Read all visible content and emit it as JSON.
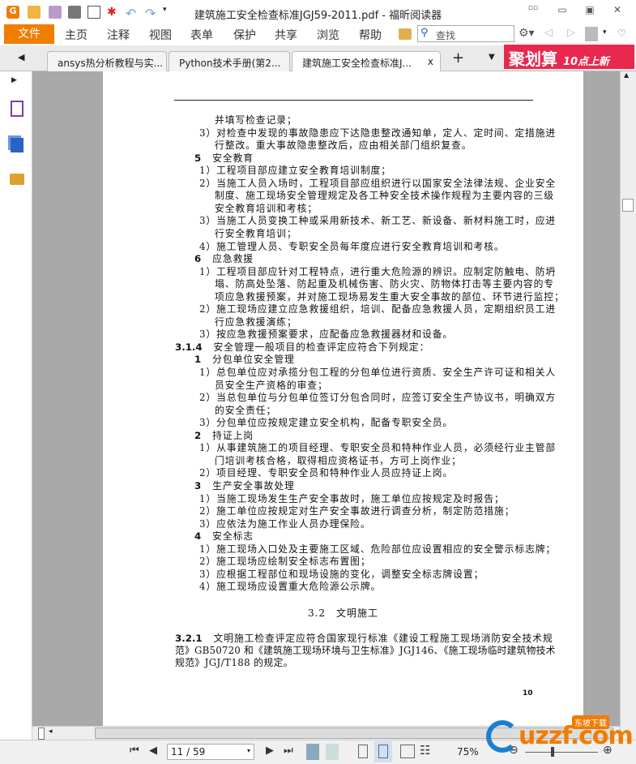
{
  "window": {
    "title": "建筑施工安全检查标准JGJ59-2011.pdf - 福昕阅读器"
  },
  "menu": {
    "file": "文件",
    "items": [
      "主页",
      "注释",
      "视图",
      "表单",
      "保护",
      "共享",
      "浏览",
      "帮助"
    ],
    "search_placeholder": "查找"
  },
  "tabs": [
    {
      "label": "ansys热分析教程与实..."
    },
    {
      "label": "Python技术手册(第2..."
    },
    {
      "label": "建筑施工安全检查标准J...",
      "close": "x"
    }
  ],
  "tab_add": "+",
  "ad": {
    "main": "聚划算",
    "sub": "10点上新"
  },
  "doc": {
    "lines": [
      {
        "t": "并填写检查记录；",
        "k": "c"
      },
      {
        "t": "3）对检查中发现的事故隐患应下达隐患整改通知单，定人、定时间、定措施进",
        "k": "i"
      },
      {
        "t": "行整改。重大事故隐患整改后，应由相关部门组织复查。",
        "k": "c"
      },
      {
        "n": "5",
        "t": "安全教育",
        "k": "h"
      },
      {
        "t": "1）工程项目部应建立安全教育培训制度；",
        "k": "i"
      },
      {
        "t": "2）当施工人员入场时，工程项目部应组织进行以国家安全法律法规、企业安全",
        "k": "i"
      },
      {
        "t": "制度、施工现场安全管理规定及各工种安全技术操作规程为主要内容的三级",
        "k": "c"
      },
      {
        "t": "安全教育培训和考核；",
        "k": "c"
      },
      {
        "t": "3）当施工人员变换工种或采用新技术、新工艺、新设备、新材料施工时，应进",
        "k": "i"
      },
      {
        "t": "行安全教育培训；",
        "k": "c"
      },
      {
        "t": "4）施工管理人员、专职安全员每年度应进行安全教育培训和考核。",
        "k": "i"
      },
      {
        "n": "6",
        "t": "应急救援",
        "k": "h"
      },
      {
        "t": "1）工程项目部应针对工程特点，进行重大危险源的辨识。应制定防触电、防坍",
        "k": "i"
      },
      {
        "t": "塌、防高处坠落、防起重及机械伤害、防火灾、防物体打击等主要内容的专",
        "k": "c"
      },
      {
        "t": "项应急救援预案，并对施工现场易发生重大安全事故的部位、环节进行监控；",
        "k": "c"
      },
      {
        "t": "2）施工现场应建立应急救援组织，培训、配备应急救援人员，定期组织员工进",
        "k": "i"
      },
      {
        "t": "行应急救援演练；",
        "k": "c"
      },
      {
        "t": "3）按应急救援预案要求，应配备应急救援器材和设备。",
        "k": "i"
      },
      {
        "n": "3.1.4",
        "t": "安全管理一般项目的检查评定应符合下列规定：",
        "k": "s"
      },
      {
        "n": "1",
        "t": "分包单位安全管理",
        "k": "h"
      },
      {
        "t": "1）总包单位应对承揽分包工程的分包单位进行资质、安全生产许可证和相关人",
        "k": "i"
      },
      {
        "t": "员安全生产资格的审查；",
        "k": "c"
      },
      {
        "t": "2）当总包单位与分包单位签订分包合同时，应签订安全生产协议书，明确双方",
        "k": "i"
      },
      {
        "t": "的安全责任；",
        "k": "c"
      },
      {
        "t": "3）分包单位应按规定建立安全机构，配备专职安全员。",
        "k": "i"
      },
      {
        "n": "2",
        "t": "持证上岗",
        "k": "h"
      },
      {
        "t": "1）从事建筑施工的项目经理、专职安全员和特种作业人员，必须经行业主管部",
        "k": "i"
      },
      {
        "t": "门培训考核合格，取得相应资格证书，方可上岗作业；",
        "k": "c"
      },
      {
        "t": "2）项目经理、专职安全员和特种作业人员应持证上岗。",
        "k": "i"
      },
      {
        "n": "3",
        "t": "生产安全事故处理",
        "k": "h"
      },
      {
        "t": "1）当施工现场发生生产安全事故时，施工单位应按规定及时报告；",
        "k": "i"
      },
      {
        "t": "2）施工单位应按规定对生产安全事故进行调查分析，制定防范措施；",
        "k": "i"
      },
      {
        "t": "3）应依法为施工作业人员办理保险。",
        "k": "i"
      },
      {
        "n": "4",
        "t": "安全标志",
        "k": "h"
      },
      {
        "t": "1）施工现场入口处及主要施工区域、危险部位应设置相应的安全警示标志牌；",
        "k": "i"
      },
      {
        "t": "2）施工现场应绘制安全标志布置图；",
        "k": "i"
      },
      {
        "t": "3）应根据工程部位和现场设施的变化，调整安全标志牌设置；",
        "k": "i"
      },
      {
        "t": "4）施工现场应设置重大危险源公示牌。",
        "k": "i"
      }
    ],
    "section_title": "3.2　文明施工",
    "para_num": "3.2.1",
    "para": [
      "文明施工检查评定应符合国家现行标准《建设工程施工现场消防安全技术规",
      "范》GB50720 和《建筑施工现场环境与卫生标准》JGJ146、《施工现场临时建筑物技术",
      "规范》JGJ/T188 的规定。"
    ],
    "page_number": "10"
  },
  "bottom": {
    "page": "11 / 59",
    "zoom": "75%"
  },
  "watermark": {
    "text": "uzzf.com",
    "badge": "东坡下载"
  }
}
